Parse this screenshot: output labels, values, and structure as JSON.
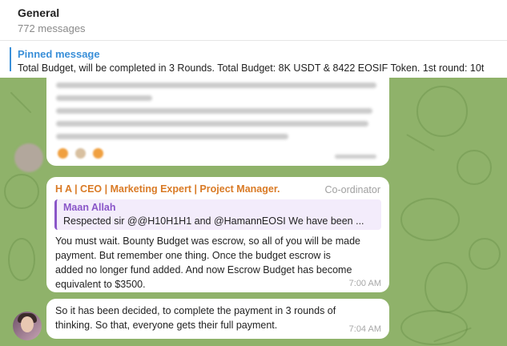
{
  "header": {
    "title": "General",
    "subtitle": "772 messages"
  },
  "pinned": {
    "title": "Pinned message",
    "text": "Total Budget, will be completed in 3 Rounds. Total Budget: 8K USDT & 8422 EOSIF Token.   1st round: 10t"
  },
  "messages": [
    {
      "sender": "H A | CEO | Marketing Expert | Project Manager.",
      "role": "Co-ordinator",
      "reply": {
        "name": "Maan Allah",
        "text": "Respected sir @@H10H1H1 and @HamannEOSI  We have been ..."
      },
      "lines": [
        "You must wait. Bounty Budget was escrow, so all of you will be made",
        "payment. But remember one thing. Once the budget escrow is",
        "added no longer fund added. And now Escrow Budget has become",
        "equivalent to $3500."
      ],
      "time": "7:00 AM"
    },
    {
      "lines": [
        "So it has been decided, to complete the payment in 3 rounds of",
        "thinking. So that, everyone gets their full payment."
      ],
      "time": "7:04 AM"
    }
  ],
  "colors": {
    "accent": "#3a8fd8",
    "sender": "#d97a25",
    "reply": "#8a56c8",
    "wallpaper": "#8fb26a"
  }
}
